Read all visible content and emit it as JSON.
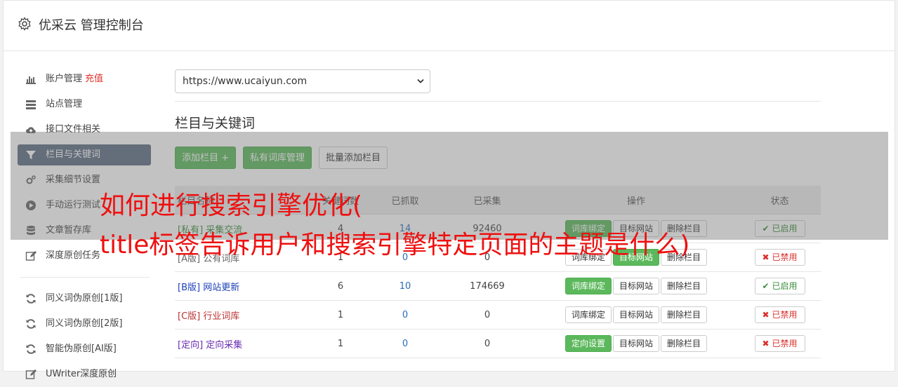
{
  "header": {
    "title": "优采云 管理控制台",
    "icon": "gear-icon"
  },
  "sidebar": {
    "items": [
      {
        "label": "账户管理",
        "badge": "充值",
        "icon": "bar-chart-icon"
      },
      {
        "label": "站点管理",
        "icon": "server-icon"
      },
      {
        "label": "接口文件相关",
        "icon": "cloud-upload-icon"
      },
      {
        "label": "栏目与关键词",
        "icon": "filter-icon",
        "active": true
      },
      {
        "label": "采集细节设置",
        "icon": "cogs-icon"
      },
      {
        "label": "手动运行测试",
        "icon": "play-circle-icon"
      },
      {
        "label": "文章暂存库",
        "icon": "database-icon"
      },
      {
        "label": "深度原创任务",
        "icon": "edit-icon"
      }
    ],
    "items2": [
      {
        "label": "同义词伪原创[1版]",
        "icon": "refresh-icon"
      },
      {
        "label": "同义词伪原创[2版]",
        "icon": "refresh-icon"
      },
      {
        "label": "智能伪原创[AI版]",
        "icon": "refresh-icon"
      },
      {
        "label": "UWriter深度原创",
        "icon": "edit-icon"
      }
    ]
  },
  "main": {
    "site_select": "https://www.ucaiyun.com",
    "section_title": "栏目与关键词",
    "buttons": {
      "add": "添加栏目 +",
      "private_lib": "私有词库管理",
      "batch_add": "批量添加栏目"
    },
    "table": {
      "headers": [
        "栏目名称",
        "关键词数",
        "已抓取",
        "已采集",
        "操作",
        "状态"
      ],
      "rows": [
        {
          "tag": "[私有]",
          "name": "采集交流",
          "kw": "4",
          "crawled": "14",
          "collected": "92460",
          "bind": "词库绑定",
          "target": "目标网站",
          "delete": "删除栏目",
          "status": "已启用"
        },
        {
          "tag": "[A版]",
          "name": "公有词库",
          "kw": "1",
          "crawled": "0",
          "collected": "0",
          "bind": "词库绑定",
          "target": "目标网站",
          "delete": "删除栏目",
          "status": "已禁用"
        },
        {
          "tag": "[B版]",
          "name": "网站更新",
          "kw": "6",
          "crawled": "10",
          "collected": "174669",
          "bind": "词库绑定",
          "target": "目标网站",
          "delete": "删除栏目",
          "status": "已启用"
        },
        {
          "tag": "[C版]",
          "name": "行业词库",
          "kw": "1",
          "crawled": "0",
          "collected": "0",
          "bind": "词库绑定",
          "target": "目标网站",
          "delete": "删除栏目",
          "status": "已禁用"
        },
        {
          "tag": "[定向]",
          "name": "定向采集",
          "kw": "1",
          "crawled": "0",
          "collected": "0",
          "bind": "定向设置",
          "target": "目标网站",
          "delete": "删除栏目",
          "status": "已禁用"
        }
      ]
    }
  },
  "overlay": {
    "line1": "如何进行搜索引擎优化(",
    "line2": "title标签告诉用户和搜索引擎特定页面的主题是什么)"
  },
  "colors": {
    "green": "#5cb85c",
    "active_nav": "#5d6d83",
    "overlay_text": "#ef1010",
    "recharge": "#e0322b"
  }
}
